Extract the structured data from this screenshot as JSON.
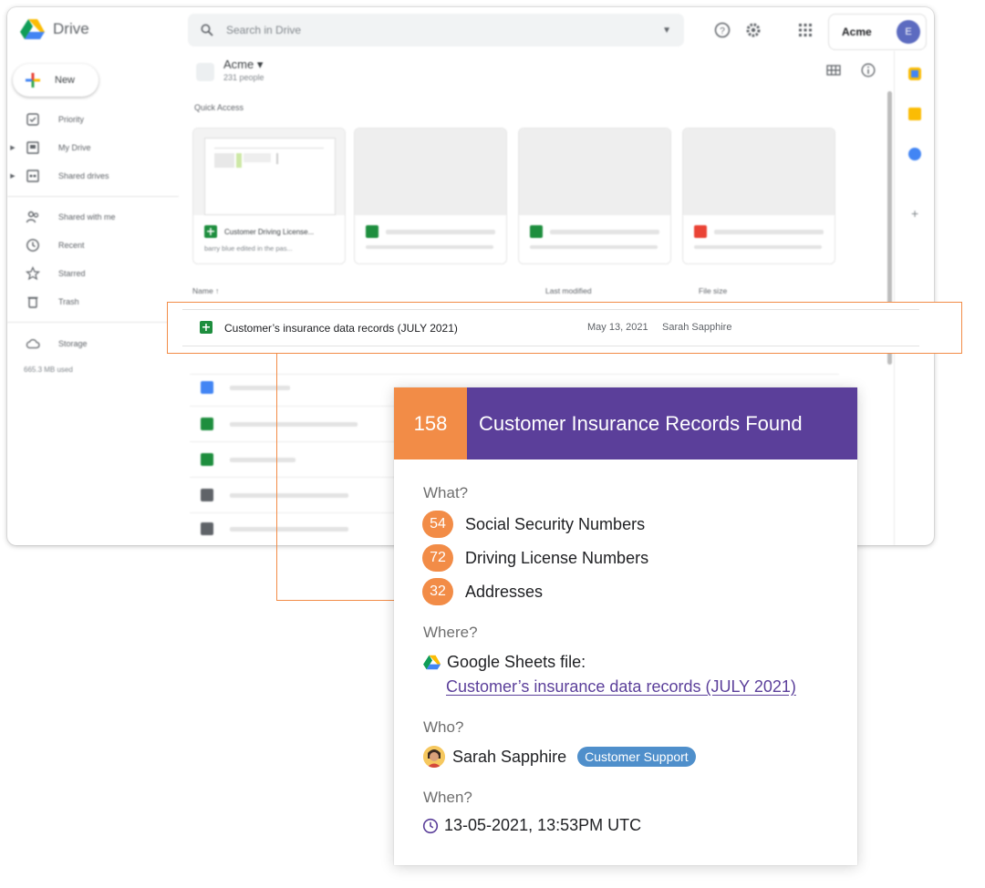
{
  "drive": {
    "app_name": "Drive",
    "search_placeholder": "Search in Drive",
    "account_name": "Acme",
    "avatar_initial": "E",
    "new_label": "New",
    "nav": {
      "priority": "Priority",
      "my_drive": "My Drive",
      "shared_drives": "Shared drives",
      "shared_with_me": "Shared with me",
      "recent": "Recent",
      "starred": "Starred",
      "trash": "Trash",
      "storage": "Storage",
      "storage_used": "665.3 MB used"
    },
    "folder_title": "Acme",
    "folder_subtitle": "231 people",
    "quick_access_label": "Quick Access",
    "quick_access_card": {
      "title": "Customer Driving License...",
      "subtitle": "barry blue edited in the pas..."
    },
    "columns": {
      "name": "Name",
      "last_modified": "Last modified",
      "file_size": "File size"
    }
  },
  "highlight": {
    "file_name": "Customer’s insurance data records (JULY 2021)",
    "date": "May 13, 2021",
    "owner": "Sarah Sapphire"
  },
  "card": {
    "count": "158",
    "title": "Customer Insurance Records Found",
    "what_label": "What?",
    "findings": [
      {
        "count": "54",
        "label": "Social Security Numbers"
      },
      {
        "count": "72",
        "label": "Driving License Numbers"
      },
      {
        "count": "32",
        "label": "Addresses"
      }
    ],
    "where_label": "Where?",
    "where_type": "Google Sheets file:",
    "where_file": "Customer’s insurance data records (JULY 2021)",
    "who_label": "Who?",
    "who_name": "Sarah Sapphire",
    "who_team": "Customer Support",
    "when_label": "When?",
    "when_value": "13-05-2021, 13:53PM UTC"
  },
  "colors": {
    "accent_orange": "#f28c47",
    "header_purple": "#5b3f9a",
    "badge_blue": "#4f8fcb",
    "sheets_green": "#1e8e3e",
    "docs_blue": "#4285f4"
  }
}
